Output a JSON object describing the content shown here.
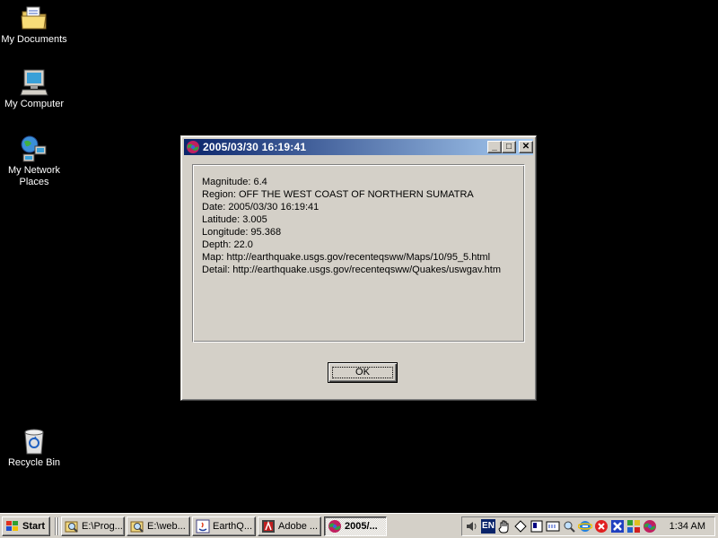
{
  "desktop": {
    "icons": [
      {
        "label": "My Documents",
        "icon": "folder-documents-icon"
      },
      {
        "label": "My Computer",
        "icon": "computer-icon"
      },
      {
        "label": "My Network Places",
        "icon": "network-places-icon"
      },
      {
        "label": "Recycle Bin",
        "icon": "recycle-bin-icon"
      }
    ]
  },
  "dialog": {
    "title": "2005/03/30 16:19:41",
    "lines": [
      "Magnitude: 6.4",
      "Region: OFF THE WEST COAST OF NORTHERN SUMATRA",
      "Date: 2005/03/30 16:19:41",
      "Latitude: 3.005",
      "Longitude: 95.368",
      "Depth: 22.0",
      "Map: http://earthquake.usgs.gov/recenteqsww/Maps/10/95_5.html",
      "Detail: http://earthquake.usgs.gov/recenteqsww/Quakes/uswgav.htm"
    ],
    "ok_label": "OK",
    "minimize_label": "_",
    "maximize_label": "□",
    "close_label": "✕"
  },
  "taskbar": {
    "start_label": "Start",
    "tasks": [
      {
        "label": "E:\\Prog...",
        "icon": "explorer-search-icon"
      },
      {
        "label": "E:\\web...",
        "icon": "explorer-search-icon"
      },
      {
        "label": "EarthQ...",
        "icon": "java-icon"
      },
      {
        "label": "Adobe ...",
        "icon": "adobe-icon"
      },
      {
        "label": "2005/...",
        "icon": "earthquake-app-icon",
        "active": true
      }
    ],
    "tray": {
      "language": "EN",
      "clock": "1:34 AM"
    }
  },
  "colors": {
    "desktop": "#000000",
    "titlebar_start": "#0a246a",
    "titlebar_end": "#a6caf0",
    "face": "#d4d0c8"
  }
}
